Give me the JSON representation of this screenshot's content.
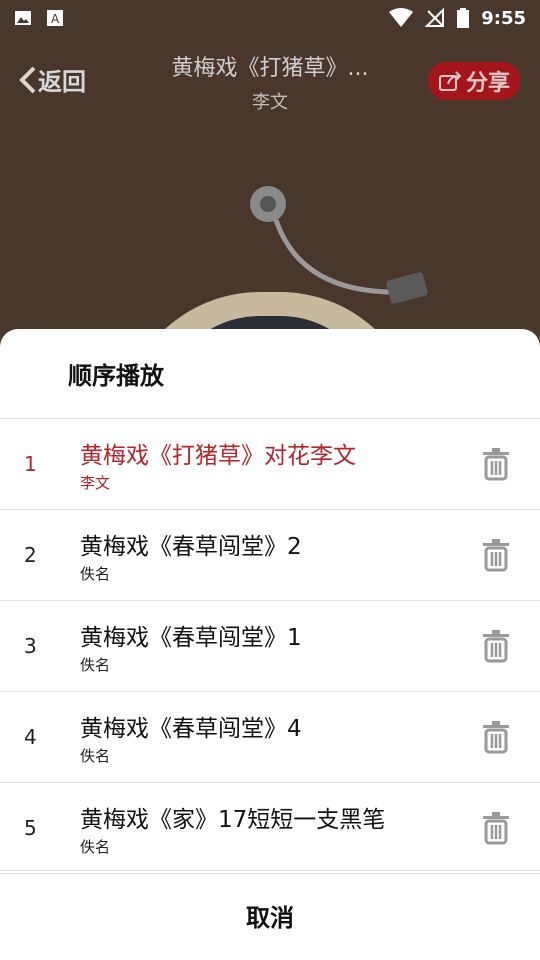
{
  "status_bar": {
    "time": "9:55"
  },
  "header": {
    "back_label": "返回",
    "song_title": "黄梅戏《打猪草》...",
    "artist": "李文",
    "share_label": "分享"
  },
  "playlist": {
    "mode_label": "顺序播放",
    "items": [
      {
        "index": "1",
        "title": "黄梅戏《打猪草》对花李文",
        "artist": "李文",
        "active": true
      },
      {
        "index": "2",
        "title": "黄梅戏《春草闯堂》2",
        "artist": "佚名",
        "active": false
      },
      {
        "index": "3",
        "title": "黄梅戏《春草闯堂》1",
        "artist": "佚名",
        "active": false
      },
      {
        "index": "4",
        "title": "黄梅戏《春草闯堂》4",
        "artist": "佚名",
        "active": false
      },
      {
        "index": "5",
        "title": "黄梅戏《家》17短短一支黑笔",
        "artist": "佚名",
        "active": false
      }
    ],
    "cancel_label": "取消"
  },
  "colors": {
    "active": "#b3242a",
    "background": "#4a372c",
    "share": "#a4161c"
  }
}
